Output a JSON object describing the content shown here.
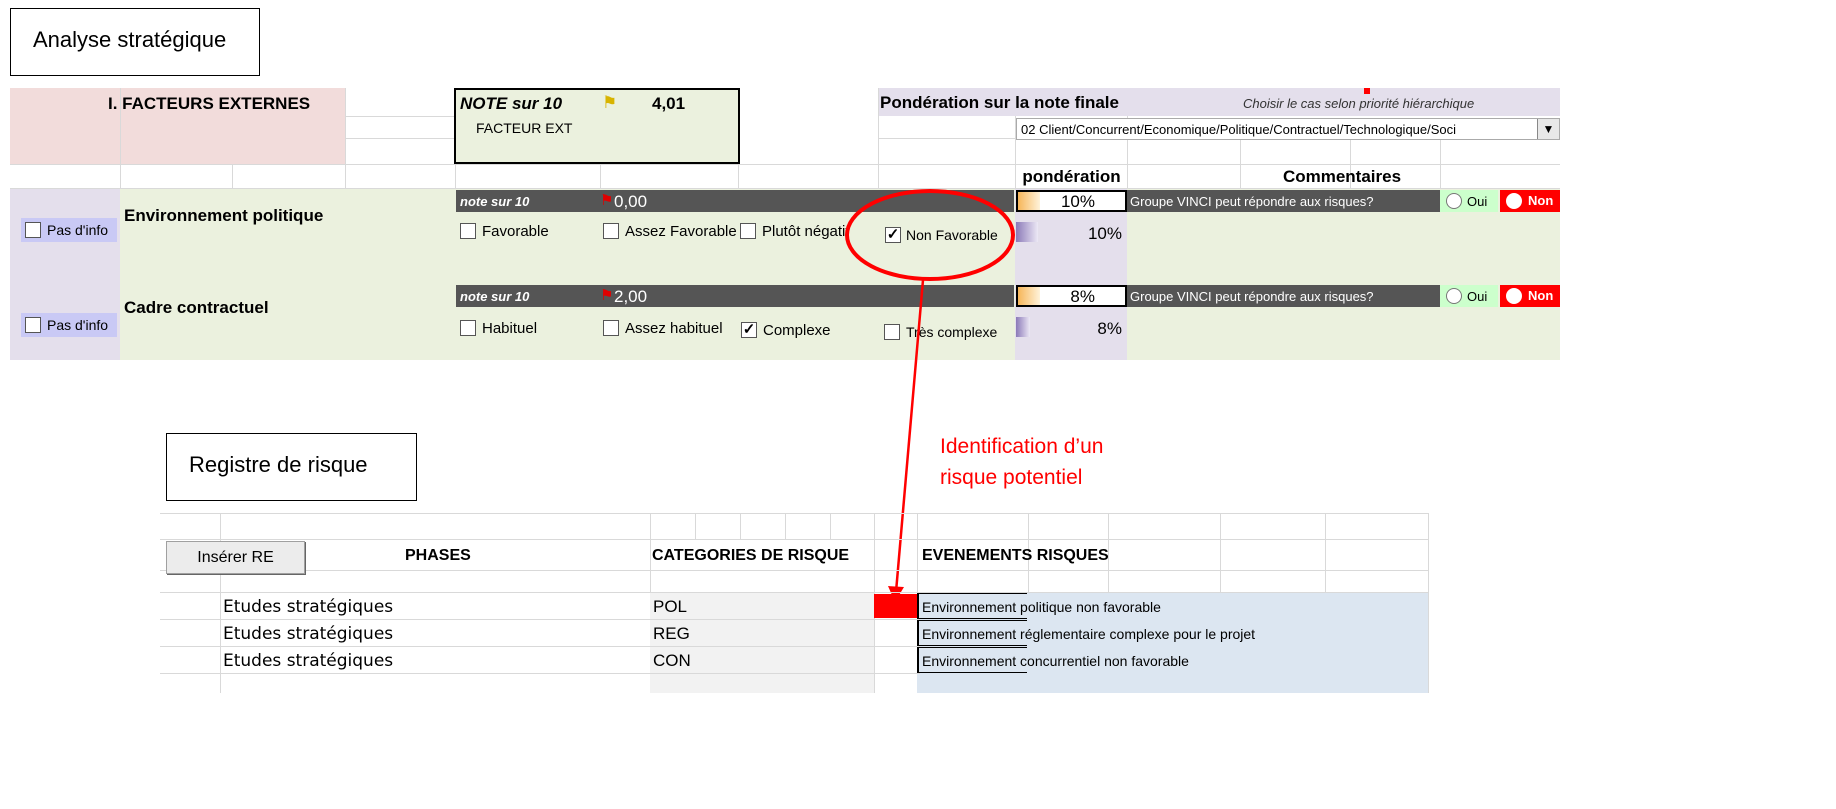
{
  "analysis_box": {
    "title": "Analyse stratégique"
  },
  "external": {
    "section_title": "I. FACTEURS EXTERNES",
    "note_label": "NOTE sur 10",
    "note_value": "4,01",
    "note_sub": "FACTEUR EXT",
    "weighting_title": "Pondération sur la note finale",
    "choose_hint": "Choisir le cas selon priorité hiérarchique",
    "dropdown_value": "02 Client/Concurrent/Economique/Politique/Contractuel/Technologique/Soci",
    "col_ponderation": "pondération",
    "col_comments": "Commentaires"
  },
  "rows": [
    {
      "no_info_label": "Pas d'info",
      "name": "Environnement politique",
      "note_label": "note sur 10",
      "note_value": "0,00",
      "options": [
        "Favorable",
        "Assez Favorable",
        "Plutôt négatif",
        "Non Favorable"
      ],
      "checked_index": 3,
      "weight_top": "10%",
      "weight_bottom": "10%",
      "question": "Groupe VINCI peut répondre aux risques?",
      "oui": "Oui",
      "non": "Non"
    },
    {
      "no_info_label": "Pas d'info",
      "name": "Cadre contractuel",
      "note_label": "note sur 10",
      "note_value": "2,00",
      "options": [
        "Habituel",
        "Assez habituel",
        "Complexe",
        "Très complexe"
      ],
      "checked_index": 2,
      "weight_top": "8%",
      "weight_bottom": "8%",
      "question": "Groupe VINCI peut répondre aux risques?",
      "oui": "Oui",
      "non": "Non"
    }
  ],
  "annotation": {
    "line1": "Identification d’un",
    "line2": "risque  potentiel"
  },
  "register_box": {
    "title": "Registre de risque"
  },
  "register": {
    "insert_button": "Insérer RE",
    "col_phases": "PHASES",
    "col_categories": "CATEGORIES DE RISQUE",
    "col_events": "EVENEMENTS RISQUES",
    "rows": [
      {
        "phase": "Etudes stratégiques",
        "category": "POL",
        "event": "Environnement politique non favorable"
      },
      {
        "phase": "Etudes stratégiques",
        "category": "REG",
        "event": "Environnement réglementaire complexe pour le projet"
      },
      {
        "phase": "Etudes stratégiques",
        "category": "CON",
        "event": "Environnement concurrentiel non favorable"
      }
    ]
  },
  "colors": {
    "red": "#ff0000",
    "pink": "#f2dcdb",
    "lavender": "#e4dfec",
    "green": "#ebf1de",
    "dark": "#555555",
    "blue": "#dce6f1"
  }
}
